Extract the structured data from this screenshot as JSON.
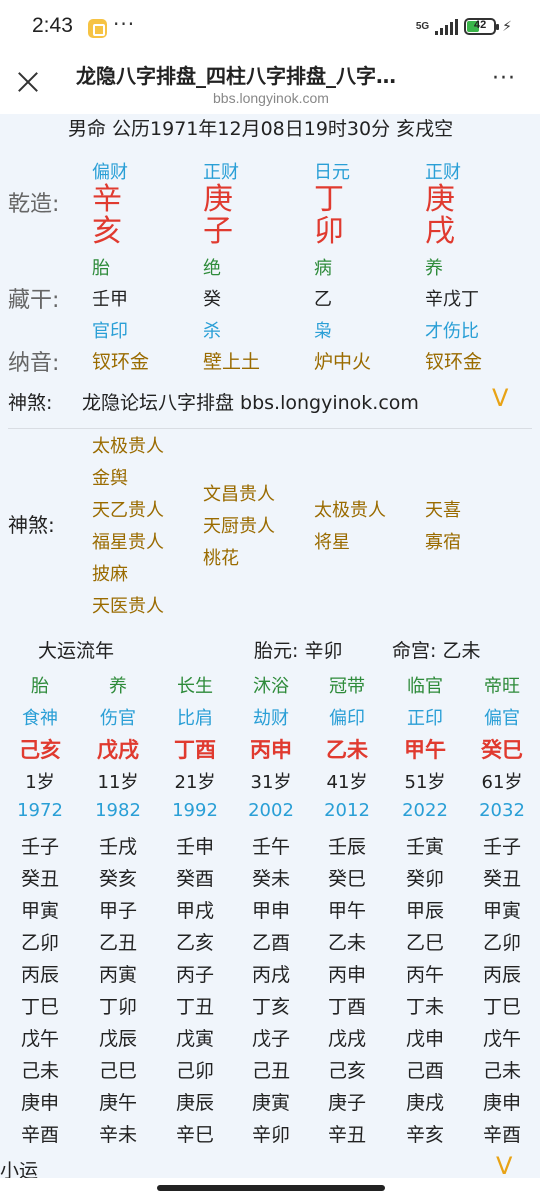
{
  "status": {
    "time": "2:43",
    "dots": "···",
    "net": "5G",
    "battery": "42"
  },
  "header": {
    "title": "龙隐八字排盘_四柱八字排盘_八字…",
    "url": "bbs.longyinok.com",
    "more": "···"
  },
  "chart": {
    "line1": "男命 公历1971年12月08日19时30分 亥戌空",
    "row_qianzao": "乾造:",
    "row_canggan": "藏干:",
    "row_nayin": "纳音:",
    "pillars": [
      {
        "shishen": "偏财",
        "gan": "辛",
        "zhi": "亥",
        "state": "胎",
        "canggan": "壬甲",
        "canggan_ss": "官印",
        "nayin": "钗环金"
      },
      {
        "shishen": "正财",
        "gan": "庚",
        "zhi": "子",
        "state": "绝",
        "canggan": "癸",
        "canggan_ss": "杀",
        "nayin": "壁上土"
      },
      {
        "shishen": "日元",
        "gan": "丁",
        "zhi": "卯",
        "state": "病",
        "canggan": "乙",
        "canggan_ss": "枭",
        "nayin": "炉中火"
      },
      {
        "shishen": "正财",
        "gan": "庚",
        "zhi": "戌",
        "state": "养",
        "canggan": "辛戊丁",
        "canggan_ss": "才伤比",
        "nayin": "钗环金"
      }
    ],
    "shensha_label": "神煞:",
    "shensha_text": "龙隐论坛八字排盘 bbs.longyinok.com",
    "expand": "V",
    "shensha_label2": "神煞:",
    "shensha_cols": [
      [
        "太极贵人",
        "金舆",
        "天乙贵人",
        "福星贵人",
        "披麻",
        "天医贵人"
      ],
      [
        "文昌贵人",
        "天厨贵人",
        "桃花"
      ],
      [
        "太极贵人",
        "将星"
      ],
      [
        "天喜",
        "寡宿"
      ]
    ]
  },
  "dayun": {
    "title": "大运流年",
    "taiyuan": "胎元:  辛卯",
    "minggong": "命宫:  乙未",
    "columns": [
      {
        "state": "胎",
        "ss": "食神",
        "gz": "己亥",
        "age": "1岁",
        "year": "1972",
        "liunian": [
          "壬子",
          "癸丑",
          "甲寅",
          "乙卯",
          "丙辰",
          "丁巳",
          "戊午",
          "己未",
          "庚申",
          "辛酉"
        ]
      },
      {
        "state": "养",
        "ss": "伤官",
        "gz": "戊戌",
        "age": "11岁",
        "year": "1982",
        "liunian": [
          "壬戌",
          "癸亥",
          "甲子",
          "乙丑",
          "丙寅",
          "丁卯",
          "戊辰",
          "己巳",
          "庚午",
          "辛未"
        ]
      },
      {
        "state": "长生",
        "ss": "比肩",
        "gz": "丁酉",
        "age": "21岁",
        "year": "1992",
        "liunian": [
          "壬申",
          "癸酉",
          "甲戌",
          "乙亥",
          "丙子",
          "丁丑",
          "戊寅",
          "己卯",
          "庚辰",
          "辛巳"
        ]
      },
      {
        "state": "沐浴",
        "ss": "劫财",
        "gz": "丙申",
        "age": "31岁",
        "year": "2002",
        "liunian": [
          "壬午",
          "癸未",
          "甲申",
          "乙酉",
          "丙戌",
          "丁亥",
          "戊子",
          "己丑",
          "庚寅",
          "辛卯"
        ]
      },
      {
        "state": "冠带",
        "ss": "偏印",
        "gz": "乙未",
        "age": "41岁",
        "year": "2012",
        "liunian": [
          "壬辰",
          "癸巳",
          "甲午",
          "乙未",
          "丙申",
          "丁酉",
          "戊戌",
          "己亥",
          "庚子",
          "辛丑"
        ]
      },
      {
        "state": "临官",
        "ss": "正印",
        "gz": "甲午",
        "age": "51岁",
        "year": "2022",
        "liunian": [
          "壬寅",
          "癸卯",
          "甲辰",
          "乙巳",
          "丙午",
          "丁未",
          "戊申",
          "己酉",
          "庚戌",
          "辛亥"
        ]
      },
      {
        "state": "帝旺",
        "ss": "偏官",
        "gz": "癸巳",
        "age": "61岁",
        "year": "2032",
        "liunian": [
          "壬子",
          "癸丑",
          "甲寅",
          "乙卯",
          "丙辰",
          "丁巳",
          "戊午",
          "己未",
          "庚申",
          "辛酉"
        ]
      }
    ]
  },
  "xiaoyun": {
    "label": "小运",
    "expand": "V"
  }
}
